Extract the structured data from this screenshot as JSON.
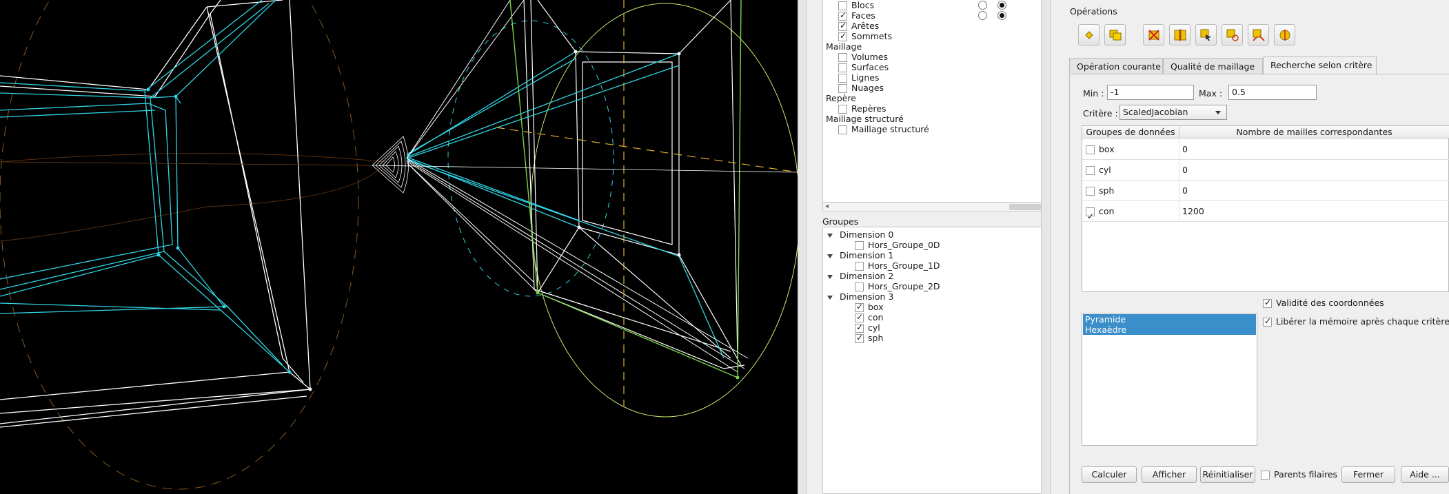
{
  "filters": {
    "partial_category": {
      "items": [
        {
          "label": "Blocs",
          "checked": false
        },
        {
          "label": "Faces",
          "checked": true
        },
        {
          "label": "Arêtes",
          "checked": true
        },
        {
          "label": "Sommets",
          "checked": true
        }
      ]
    },
    "categories": [
      {
        "title": "Maillage",
        "items": [
          {
            "label": "Volumes",
            "checked": false
          },
          {
            "label": "Surfaces",
            "checked": false
          },
          {
            "label": "Lignes",
            "checked": false
          },
          {
            "label": "Nuages",
            "checked": false
          }
        ]
      },
      {
        "title": "Repère",
        "items": [
          {
            "label": "Repères",
            "checked": false
          }
        ]
      },
      {
        "title": "Maillage structuré",
        "items": [
          {
            "label": "Maillage structuré",
            "checked": false
          }
        ]
      }
    ]
  },
  "groups": {
    "title": "Groupes",
    "dimensions": [
      {
        "label": "Dimension 0",
        "children": [
          {
            "label": "Hors_Groupe_0D",
            "checked": false
          }
        ]
      },
      {
        "label": "Dimension 1",
        "children": [
          {
            "label": "Hors_Groupe_1D",
            "checked": false
          }
        ]
      },
      {
        "label": "Dimension 2",
        "children": [
          {
            "label": "Hors_Groupe_2D",
            "checked": false
          }
        ]
      },
      {
        "label": "Dimension 3",
        "children": [
          {
            "label": "box",
            "checked": true
          },
          {
            "label": "con",
            "checked": true
          },
          {
            "label": "cyl",
            "checked": true
          },
          {
            "label": "sph",
            "checked": true
          }
        ]
      }
    ]
  },
  "operations": {
    "title": "Opérations",
    "tools": [
      "point-tool-icon",
      "copy-tool-icon",
      "delete-tool-icon",
      "split-tool-icon",
      "select-tool-icon",
      "select-edit-tool-icon",
      "select-extend-tool-icon",
      "sphere-tool-icon"
    ],
    "tabs": [
      {
        "label": "Opération courante",
        "active": false
      },
      {
        "label": "Qualité de maillage",
        "active": false
      },
      {
        "label": "Recherche selon critère",
        "active": true
      }
    ]
  },
  "criteria": {
    "min_label": "Min :",
    "min_value": "-1",
    "max_label": "Max :",
    "max_value": "0.5",
    "criterion_label": "Critère :",
    "criterion_value": "ScaledJacobian",
    "table": {
      "headers": [
        "Groupes de données",
        "Nombre de mailles correspondantes"
      ],
      "rows": [
        {
          "checked": false,
          "name": "box",
          "count": "0"
        },
        {
          "checked": false,
          "name": "cyl",
          "count": "0"
        },
        {
          "checked": false,
          "name": "sph",
          "count": "0"
        },
        {
          "checked": true,
          "name": "con",
          "count": "1200"
        }
      ]
    },
    "cell_types": [
      "Pyramide",
      "Hexaèdre"
    ],
    "options": [
      {
        "label": "Validité des coordonnées",
        "checked": true
      },
      {
        "label": "Libérer la mémoire après chaque critère",
        "checked": true
      }
    ]
  },
  "buttons": {
    "calculer": "Calculer",
    "afficher": "Afficher",
    "reinitialiser": "Réinitialiser",
    "parents_label": "Parents filaires",
    "parents_checked": false,
    "fermer": "Fermer",
    "aide": "Aide ..."
  },
  "colors": {
    "viewport_bg": "#000000",
    "mesh_cyan": "#2fd6e6",
    "mesh_white": "#ffffff",
    "selection_blue": "#3a8ec9"
  }
}
